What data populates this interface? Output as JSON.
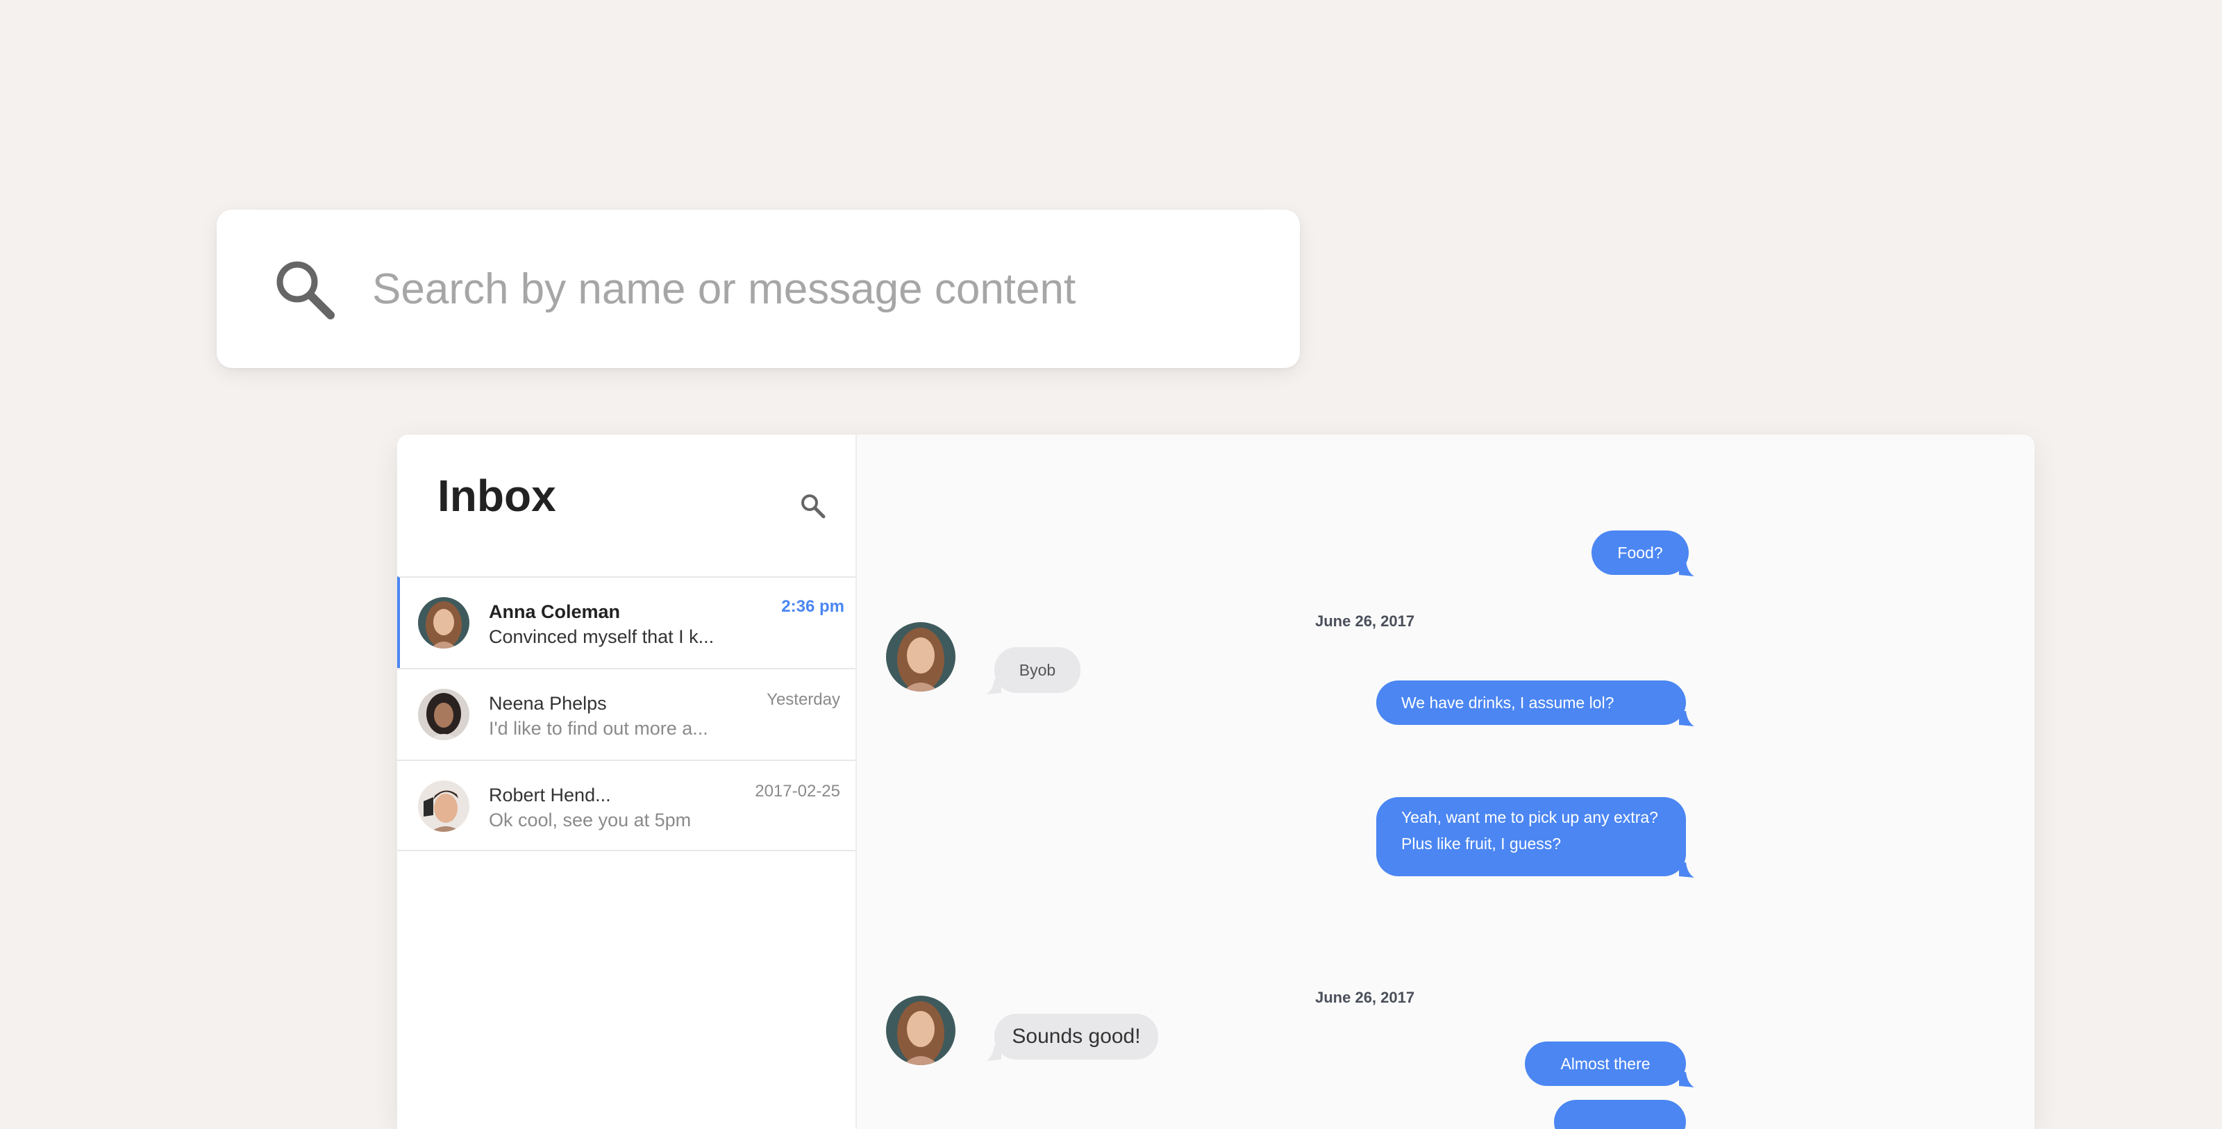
{
  "search": {
    "placeholder": "Search by name or message content"
  },
  "inbox": {
    "title": "Inbox",
    "conversations": [
      {
        "name": "Anna Coleman",
        "preview": "Convinced myself that I k...",
        "time": "2:36 pm",
        "active": true
      },
      {
        "name": "Neena Phelps",
        "preview": "I'd like to find out more a...",
        "time": "Yesterday",
        "active": false
      },
      {
        "name": "Robert Hend...",
        "preview": "Ok cool, see you at 5pm",
        "time": "2017-02-25",
        "active": false
      }
    ]
  },
  "chat": {
    "messages": [
      {
        "type": "out",
        "text": "Food?"
      },
      {
        "type": "date",
        "text": "June 26, 2017"
      },
      {
        "type": "in",
        "text": "Byob"
      },
      {
        "type": "out",
        "text": "We have drinks, I assume lol?"
      },
      {
        "type": "out",
        "text": "Yeah, want me to pick up any extra? Plus like fruit, I guess?"
      },
      {
        "type": "date",
        "text": "June 26, 2017"
      },
      {
        "type": "in",
        "text": "Sounds good!"
      },
      {
        "type": "out",
        "text": "Almost there"
      }
    ]
  },
  "colors": {
    "accent": "#4b86f2",
    "background": "#f4f1ef",
    "incoming_bubble": "#e8e8ea"
  },
  "icons": {
    "search": "search-icon",
    "avatar": "avatar"
  }
}
